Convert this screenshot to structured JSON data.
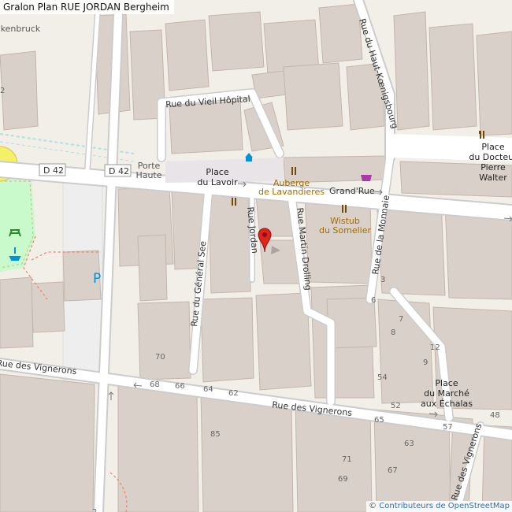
{
  "title": "Gralon Plan RUE JORDAN Bergheim",
  "attribution": {
    "prefix": "©",
    "link_text": "Contributeurs de OpenStreetMap"
  },
  "colors": {
    "background": "#f2efe9",
    "building": "#d9d0c9",
    "building_stroke": "#c4b6ab",
    "road": "#ffffff",
    "road_casing": "#cccccc",
    "park": "#c8facc",
    "parking": "#eeeeee",
    "marker": "#e2231a",
    "poi_brown": "#734a08",
    "shop_purple": "#ac39ac",
    "tourism_blue": "#0092da",
    "pedestrian": "#dddde8"
  },
  "streets": {
    "vieil_hopital": "Rue du Vieil Hôpital",
    "haut_koenigsbourg": "Rue du Haut-Kœnigsbourg",
    "general_see": "Rue du Général See",
    "jordan": "Rue Jordan",
    "martin_drolling": "Rue Martin Drolling",
    "monnaie": "Rue de la Monnaie",
    "grand_rue": "Grand'Rue",
    "vignerons_west": "Rue des Vignerons",
    "vignerons_main": "Rue des Vignerons",
    "vignerons_east": "Rue des Vignerons",
    "d42_a": "D 42",
    "d42_b": "D 42"
  },
  "places": {
    "porte_haute": [
      "Porte",
      "Haute"
    ],
    "place_lavoir": [
      "Place",
      "du Lavoir"
    ],
    "place_docteur": [
      "Place",
      "du Docteur",
      "Pierre",
      "Walter"
    ],
    "place_marche": [
      "Place",
      "du Marché",
      "aux Échalas"
    ],
    "kenbruck": "kenbruck"
  },
  "pois": {
    "auberge": [
      "Auberge",
      "de Lavandieres"
    ],
    "wistub": [
      "Wistub",
      "du Somelier"
    ]
  },
  "house_numbers": [
    "2",
    "3",
    "6",
    "7",
    "8",
    "9",
    "12",
    "54",
    "52",
    "48",
    "57",
    "70",
    "68",
    "66",
    "64",
    "62",
    "65",
    "85",
    "63",
    "71",
    "69",
    "67",
    "2"
  ],
  "icons": {
    "restaurant": "restaurant-icon",
    "museum": "museum-icon",
    "shop": "shop-icon",
    "picnic": "picnic-table-icon",
    "fountain": "fountain-icon",
    "parking": "P",
    "marker": "map-marker-icon"
  }
}
